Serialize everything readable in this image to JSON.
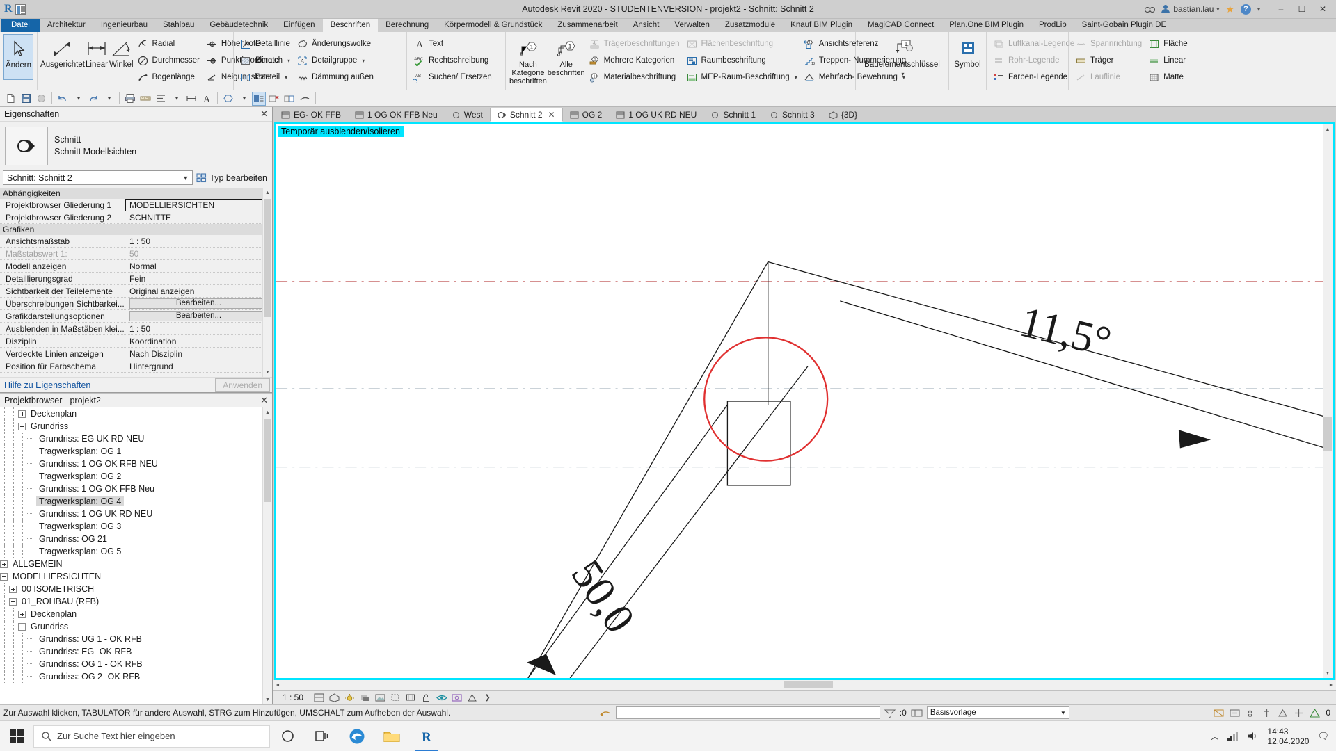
{
  "titlebar": {
    "title": "Autodesk Revit 2020 - STUDENTENVERSION - projekt2 - Schnitt: Schnitt 2",
    "search_placeholder": "",
    "user": "bastian.lau",
    "min": "–",
    "max": "☐",
    "close": "✕",
    "help": "?"
  },
  "ribbon_tabs": [
    {
      "label": "Datei",
      "state": "file"
    },
    {
      "label": "Architektur",
      "state": "normal"
    },
    {
      "label": "Ingenieurbau",
      "state": "normal"
    },
    {
      "label": "Stahlbau",
      "state": "normal"
    },
    {
      "label": "Gebäudetechnik",
      "state": "normal"
    },
    {
      "label": "Einfügen",
      "state": "normal"
    },
    {
      "label": "Beschriften",
      "state": "active"
    },
    {
      "label": "Berechnung",
      "state": "normal"
    },
    {
      "label": "Körpermodell & Grundstück",
      "state": "normal"
    },
    {
      "label": "Zusammenarbeit",
      "state": "normal"
    },
    {
      "label": "Ansicht",
      "state": "normal"
    },
    {
      "label": "Verwalten",
      "state": "normal"
    },
    {
      "label": "Zusatzmodule",
      "state": "normal"
    },
    {
      "label": "Knauf BIM Plugin",
      "state": "normal"
    },
    {
      "label": "MagiCAD Connect",
      "state": "normal"
    },
    {
      "label": "Plan.One BIM Plugin",
      "state": "normal"
    },
    {
      "label": "ProdLib",
      "state": "normal"
    },
    {
      "label": "Saint-Gobain Plugin DE",
      "state": "normal"
    }
  ],
  "ribbon": {
    "select_panel": {
      "button": "Ändern"
    },
    "dimension_panel": {
      "big": [
        "Ausgerichtet",
        "Linear",
        "Winkel"
      ],
      "small_col1": [
        "Radial",
        "Durchmesser",
        "Bogenlänge"
      ],
      "small_col2": [
        "Höhenkote",
        "Punktkoordinate",
        "Neigungskote"
      ]
    },
    "detail_panel": {
      "col1": [
        "Detaillinie",
        "Bereich",
        "Bauteil"
      ],
      "col2": [
        "Änderungswolke",
        "Detailgruppe",
        "Dämmung außen"
      ]
    },
    "text_panel": {
      "items": [
        "Text",
        "Rechtschreibung",
        "Suchen/ Ersetzen"
      ]
    },
    "tag_panel": {
      "big": [
        "Nach Kategorie beschriften",
        "Alle beschriften"
      ],
      "col1": [
        {
          "label": "Trägerbeschriftungen",
          "disabled": true
        },
        {
          "label": "Mehrere Kategorien",
          "disabled": false
        },
        {
          "label": "Materialbeschriftung",
          "disabled": false
        }
      ],
      "col2": [
        {
          "label": "Flächenbeschriftung",
          "disabled": true
        },
        {
          "label": "Raumbeschriftung",
          "disabled": false
        },
        {
          "label": "MEP-Raum-Beschriftung",
          "disabled": false
        }
      ],
      "col3": [
        {
          "label": "Ansichtsreferenz",
          "disabled": false
        },
        {
          "label": "Treppen- Nummerierung",
          "disabled": false
        },
        {
          "label": "Mehrfach- Bewehrung",
          "disabled": false
        }
      ]
    },
    "key_panel": {
      "big": "Bauelementschlüssel"
    },
    "symbol_panel": {
      "big": "Symbol"
    },
    "legend_panel": {
      "items": [
        {
          "label": "Luftkanal-Legende",
          "disabled": true
        },
        {
          "label": "Rohr-Legende",
          "disabled": true
        },
        {
          "label": "Farben-Legende",
          "disabled": false
        }
      ]
    },
    "carpentry_panel": {
      "items": [
        {
          "label": "Spannrichtung",
          "disabled": true
        },
        {
          "label": "Träger",
          "disabled": false
        },
        {
          "label": "Lauflinie",
          "disabled": true
        }
      ],
      "items2": [
        {
          "label": "Fläche",
          "disabled": false
        },
        {
          "label": "Linear",
          "disabled": false
        },
        {
          "label": "Matte",
          "disabled": false
        }
      ]
    }
  },
  "properties": {
    "panel_title": "Eigenschaften",
    "close": "✕",
    "family": "Schnitt",
    "type": "Schnitt Modellsichten",
    "type_selector": "Schnitt: Schnitt 2",
    "edit_type_label": "Typ bearbeiten",
    "groups": [
      {
        "name": "Abhängigkeiten",
        "rows": [
          {
            "key": "Projektbrowser Gliederung 1",
            "value": "MODELLIERSICHTEN",
            "style": "boxed"
          },
          {
            "key": "Projektbrowser Gliederung 2",
            "value": "SCHNITTE",
            "style": "normal"
          }
        ]
      },
      {
        "name": "Grafiken",
        "rows": [
          {
            "key": "Ansichtsmaßstab",
            "value": "1 : 50",
            "style": "normal"
          },
          {
            "key": "Maßstabswert 1:",
            "value": "50",
            "style": "dim"
          },
          {
            "key": "Modell anzeigen",
            "value": "Normal",
            "style": "normal"
          },
          {
            "key": "Detaillierungsgrad",
            "value": "Fein",
            "style": "normal"
          },
          {
            "key": "Sichtbarkeit der Teilelemente",
            "value": "Original anzeigen",
            "style": "normal"
          },
          {
            "key": "Überschreibungen Sichtbarkei...",
            "value": "Bearbeiten...",
            "style": "button"
          },
          {
            "key": "Grafikdarstellungsoptionen",
            "value": "Bearbeiten...",
            "style": "button"
          },
          {
            "key": "Ausblenden in Maßstäben klei...",
            "value": "1 : 50",
            "style": "normal"
          },
          {
            "key": "Disziplin",
            "value": "Koordination",
            "style": "normal"
          },
          {
            "key": "Verdeckte Linien anzeigen",
            "value": "Nach Disziplin",
            "style": "normal"
          },
          {
            "key": "Position für Farbschema",
            "value": "Hintergrund",
            "style": "normal"
          }
        ]
      }
    ],
    "help_link": "Hilfe zu Eigenschaften",
    "apply_button": "Anwenden"
  },
  "browser": {
    "panel_title": "Projektbrowser - projekt2",
    "close": "✕",
    "nodes": [
      {
        "label": "Deckenplan",
        "depth": 3,
        "toggle": "plus",
        "selected": false
      },
      {
        "label": "Grundriss",
        "depth": 3,
        "toggle": "minus",
        "selected": false
      },
      {
        "label": "Grundriss: EG UK RD NEU",
        "depth": 4,
        "toggle": "none",
        "selected": false
      },
      {
        "label": "Tragwerksplan: OG 1",
        "depth": 4,
        "toggle": "none",
        "selected": false
      },
      {
        "label": "Grundriss: 1 OG OK RFB NEU",
        "depth": 4,
        "toggle": "none",
        "selected": false
      },
      {
        "label": "Tragwerksplan: OG 2",
        "depth": 4,
        "toggle": "none",
        "selected": false
      },
      {
        "label": "Grundriss: 1 OG OK FFB Neu",
        "depth": 4,
        "toggle": "none",
        "selected": false
      },
      {
        "label": "Tragwerksplan: OG 4",
        "depth": 4,
        "toggle": "none",
        "selected": true
      },
      {
        "label": "Grundriss: 1 OG UK RD NEU",
        "depth": 4,
        "toggle": "none",
        "selected": false
      },
      {
        "label": "Tragwerksplan: OG 3",
        "depth": 4,
        "toggle": "none",
        "selected": false
      },
      {
        "label": "Grundriss: OG 21",
        "depth": 4,
        "toggle": "none",
        "selected": false
      },
      {
        "label": "Tragwerksplan: OG 5",
        "depth": 4,
        "toggle": "none",
        "selected": false
      },
      {
        "label": "ALLGEMEIN",
        "depth": 1,
        "toggle": "plus",
        "selected": false
      },
      {
        "label": "MODELLIERSICHTEN",
        "depth": 1,
        "toggle": "minus",
        "selected": false
      },
      {
        "label": "00 ISOMETRISCH",
        "depth": 2,
        "toggle": "plus",
        "selected": false
      },
      {
        "label": "01_ROHBAU (RFB)",
        "depth": 2,
        "toggle": "minus",
        "selected": false
      },
      {
        "label": "Deckenplan",
        "depth": 3,
        "toggle": "plus",
        "selected": false
      },
      {
        "label": "Grundriss",
        "depth": 3,
        "toggle": "minus",
        "selected": false
      },
      {
        "label": "Grundriss: UG 1 - OK RFB",
        "depth": 4,
        "toggle": "none",
        "selected": false
      },
      {
        "label": "Grundriss: EG- OK RFB",
        "depth": 4,
        "toggle": "none",
        "selected": false
      },
      {
        "label": "Grundriss: OG 1 - OK RFB",
        "depth": 4,
        "toggle": "none",
        "selected": false
      },
      {
        "label": "Grundriss: OG 2- OK RFB",
        "depth": 4,
        "toggle": "none",
        "selected": false
      }
    ]
  },
  "view_tabs": [
    {
      "label": "EG- OK FFB",
      "icon": "plan",
      "active": false
    },
    {
      "label": "1 OG OK FFB Neu",
      "icon": "plan",
      "active": false
    },
    {
      "label": "West",
      "icon": "elev",
      "active": false
    },
    {
      "label": "Schnitt 2",
      "icon": "sect",
      "active": true,
      "closable": true
    },
    {
      "label": "OG 2",
      "icon": "plan",
      "active": false
    },
    {
      "label": "1 OG UK RD NEU",
      "icon": "plan",
      "active": false
    },
    {
      "label": "Schnitt 1",
      "icon": "elev",
      "active": false
    },
    {
      "label": "Schnitt 3",
      "icon": "elev",
      "active": false
    },
    {
      "label": "{3D}",
      "icon": "3d",
      "active": false
    }
  ],
  "canvas": {
    "temporary_banner": "Temporär ausblenden/isolieren",
    "angle_label": "11,5°",
    "length_label": "50,0",
    "scale": "1 : 50"
  },
  "viewcontrol": {
    "scale": "1 : 50",
    "icons": [
      "detail-level-icon",
      "visual-style-icon",
      "sun-path-icon",
      "shadows-icon",
      "render-icon",
      "crop-view-icon",
      "crop-region-icon",
      "lock-3d-icon",
      "temporary-hide-icon",
      "reveal-hidden-icon",
      "analytical-model-icon",
      "chevron-right-icon"
    ]
  },
  "statusbar": {
    "message": "Zur Auswahl klicken, TABULATOR für andere Auswahl, STRG zum Hinzufügen, UMSCHALT zum Aufheben der Auswahl.",
    "selection_count": ":0",
    "template": "Basisvorlage",
    "filter_count": "0"
  },
  "taskbar": {
    "search_placeholder": "Zur Suche Text hier eingeben",
    "apps": [
      "cortana-icon",
      "task-view-icon",
      "edge-icon",
      "explorer-icon",
      "revit-icon"
    ],
    "time": "14:43",
    "date": "12.04.2020",
    "tray": [
      "chevron-up-icon",
      "network-icon",
      "volume-icon"
    ],
    "notification": "☐"
  },
  "colors": {
    "accent": "#00e5ff",
    "file_tab": "#1565a8",
    "selection": "#cde1f4",
    "link": "#1254a0",
    "red_annotation": "#e03030",
    "dashed_grid": "#d08080"
  }
}
